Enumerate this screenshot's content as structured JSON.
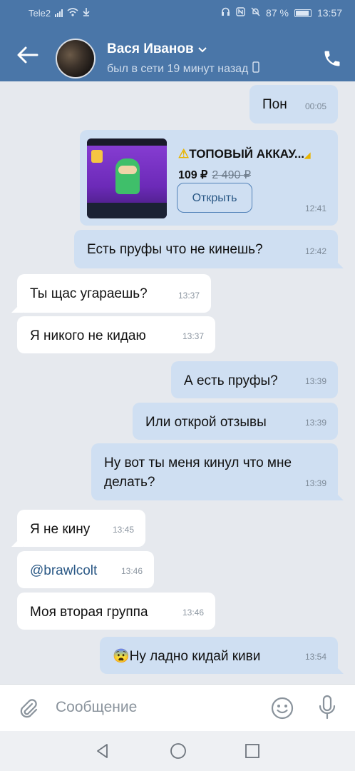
{
  "status_bar": {
    "carrier": "Tele2",
    "battery": "87 %",
    "time": "13:57"
  },
  "header": {
    "name": "Вася Иванов",
    "status": "был в сети 19 минут назад"
  },
  "card": {
    "title_prefix": "⚠",
    "title": "ТОПОВЫЙ АККАУ...",
    "price": "109 ₽",
    "old_price": "2 490 ₽",
    "button": "Открыть",
    "time": "12:41"
  },
  "messages": [
    {
      "text": "Пон",
      "time": "00:05"
    },
    {
      "text": "Есть пруфы что не кинешь?",
      "time": "12:42"
    },
    {
      "text": "Ты щас угараешь?",
      "time": "13:37"
    },
    {
      "text": "Я никого не кидаю",
      "time": "13:37"
    },
    {
      "text": "А есть пруфы?",
      "time": "13:39"
    },
    {
      "text": "Или открой отзывы",
      "time": "13:39"
    },
    {
      "text": "Ну вот ты меня кинул что мне делать?",
      "time": "13:39"
    },
    {
      "text": "Я не кину",
      "time": "13:45"
    },
    {
      "text": "@brawlcolt",
      "time": "13:46"
    },
    {
      "text": "Моя вторая группа",
      "time": "13:46"
    },
    {
      "emoji": "😨",
      "text": "Ну ладно кидай киви",
      "time": "13:54"
    }
  ],
  "composer": {
    "placeholder": "Сообщение"
  },
  "colors": {
    "header": "#4a76a8",
    "outgoing": "#cfdff2",
    "incoming": "#ffffff",
    "link": "#2a5885"
  }
}
